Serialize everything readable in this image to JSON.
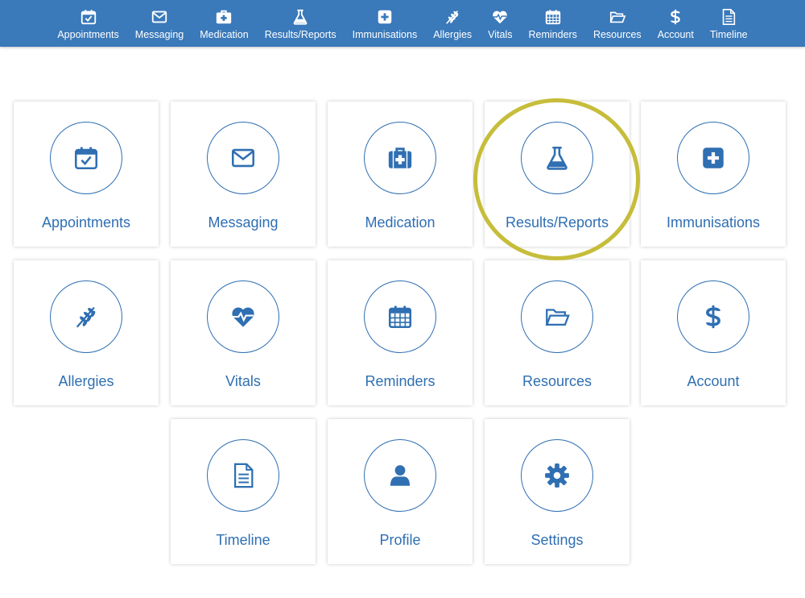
{
  "nav": {
    "items": [
      {
        "label": "Appointments",
        "icon": "calendar-check-icon"
      },
      {
        "label": "Messaging",
        "icon": "envelope-icon"
      },
      {
        "label": "Medication",
        "icon": "medkit-icon"
      },
      {
        "label": "Results/Reports",
        "icon": "flask-icon"
      },
      {
        "label": "Immunisations",
        "icon": "plus-square-icon"
      },
      {
        "label": "Allergies",
        "icon": "wheat-icon"
      },
      {
        "label": "Vitals",
        "icon": "heartbeat-icon"
      },
      {
        "label": "Reminders",
        "icon": "calendar-grid-icon"
      },
      {
        "label": "Resources",
        "icon": "folder-open-icon"
      },
      {
        "label": "Account",
        "icon": "dollar-icon"
      },
      {
        "label": "Timeline",
        "icon": "document-icon"
      }
    ]
  },
  "tiles": [
    {
      "label": "Appointments",
      "icon": "calendar-check-icon"
    },
    {
      "label": "Messaging",
      "icon": "envelope-icon"
    },
    {
      "label": "Medication",
      "icon": "medkit-icon"
    },
    {
      "label": "Results/Reports",
      "icon": "flask-icon"
    },
    {
      "label": "Immunisations",
      "icon": "plus-square-icon"
    },
    {
      "label": "Allergies",
      "icon": "wheat-icon"
    },
    {
      "label": "Vitals",
      "icon": "heartbeat-icon"
    },
    {
      "label": "Reminders",
      "icon": "calendar-grid-icon"
    },
    {
      "label": "Resources",
      "icon": "folder-open-icon"
    },
    {
      "label": "Account",
      "icon": "dollar-icon"
    },
    {
      "label": "Timeline",
      "icon": "document-icon"
    },
    {
      "label": "Profile",
      "icon": "user-icon"
    },
    {
      "label": "Settings",
      "icon": "gear-icon"
    }
  ],
  "colors": {
    "nav_bg": "#3a79ba",
    "accent": "#2f6fb2",
    "highlight": "#c6bd3a"
  }
}
